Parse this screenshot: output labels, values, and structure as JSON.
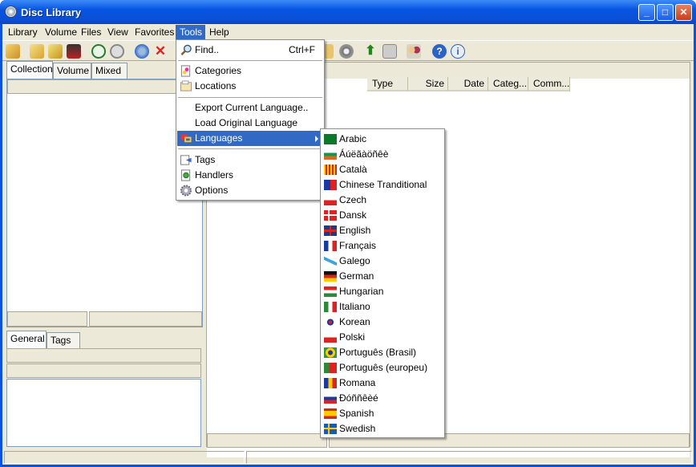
{
  "window": {
    "title": "Disc Library"
  },
  "menubar": [
    "Library",
    "Volume",
    "Files",
    "View",
    "Favorites",
    "Tools",
    "Help"
  ],
  "left_tabs": [
    "Collection",
    "Volume",
    "Mixed"
  ],
  "info_tabs": [
    "General",
    "Tags"
  ],
  "columns": [
    "Type",
    "Size",
    "Date",
    "Categ...",
    "Comm..."
  ],
  "tools_menu": {
    "find": {
      "label": "Find..",
      "shortcut": "Ctrl+F"
    },
    "categories": "Categories",
    "locations": "Locations",
    "export": "Export Current Language..",
    "load": "Load Original Language",
    "languages": "Languages",
    "tags": "Tags",
    "handlers": "Handlers",
    "options": "Options"
  },
  "languages": [
    {
      "name": "Arabic",
      "flag": "arabic"
    },
    {
      "name": "Áúëãàöñêè",
      "flag": "bulgarian"
    },
    {
      "name": "Català",
      "flag": "catala"
    },
    {
      "name": "Chinese Tranditional",
      "flag": "taiwan"
    },
    {
      "name": "Czech",
      "flag": "czech"
    },
    {
      "name": "Dansk",
      "flag": "dansk"
    },
    {
      "name": "English",
      "flag": "uk"
    },
    {
      "name": "Français",
      "flag": "france"
    },
    {
      "name": "Galego",
      "flag": "galego"
    },
    {
      "name": "German",
      "flag": "germany"
    },
    {
      "name": "Hungarian",
      "flag": "hungary"
    },
    {
      "name": "Italiano",
      "flag": "italy"
    },
    {
      "name": "Korean",
      "flag": "korea"
    },
    {
      "name": "Polski",
      "flag": "poland"
    },
    {
      "name": "Português (Brasil)",
      "flag": "brazil"
    },
    {
      "name": "Português (europeu)",
      "flag": "portugal"
    },
    {
      "name": "Romana",
      "flag": "romania"
    },
    {
      "name": "Ðóññêèé",
      "flag": "russia"
    },
    {
      "name": "Spanish",
      "flag": "spain"
    },
    {
      "name": "Swedish",
      "flag": "sweden"
    }
  ],
  "colors": {
    "highlight": "#316ac5",
    "face": "#ece9d8",
    "title": "#0a53de"
  }
}
